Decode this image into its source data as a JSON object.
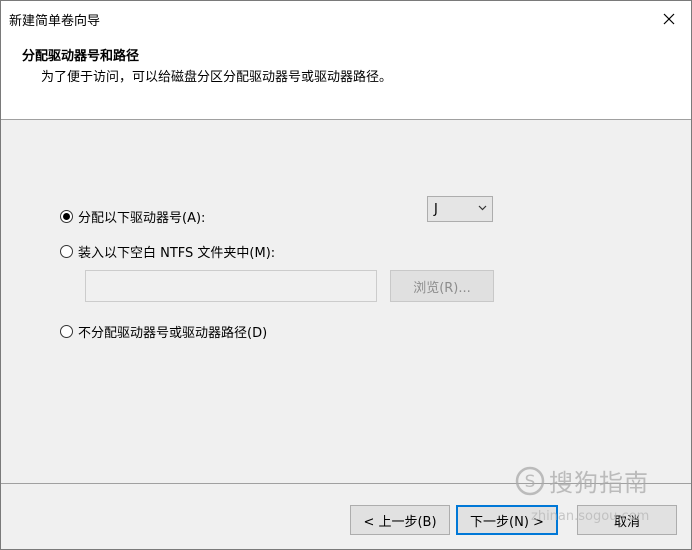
{
  "window": {
    "title": "新建简单卷向导"
  },
  "header": {
    "title": "分配驱动器号和路径",
    "subtitle": "为了便于访问，可以给磁盘分区分配驱动器号或驱动器路径。"
  },
  "options": {
    "assign_letter": {
      "label": "分配以下驱动器号(A):",
      "selected": true
    },
    "mount_folder": {
      "label": "装入以下空白 NTFS 文件夹中(M):",
      "selected": false
    },
    "no_assign": {
      "label": "不分配驱动器号或驱动器路径(D)",
      "selected": false
    }
  },
  "drive_select": {
    "value": "J"
  },
  "folder_input": {
    "value": ""
  },
  "buttons": {
    "browse": "浏览(R)...",
    "back": "< 上一步(B)",
    "next": "下一步(N) >",
    "cancel": "取消"
  },
  "watermark": {
    "text": "搜狗指南",
    "url": "zhinan.sogou.com"
  },
  "colors": {
    "accent": "#0078d7",
    "dialog_bg": "#f0f0f0",
    "header_bg": "#ffffff"
  },
  "icons": [
    "close-icon",
    "chevron-down-icon",
    "sogou-logo-icon"
  ]
}
